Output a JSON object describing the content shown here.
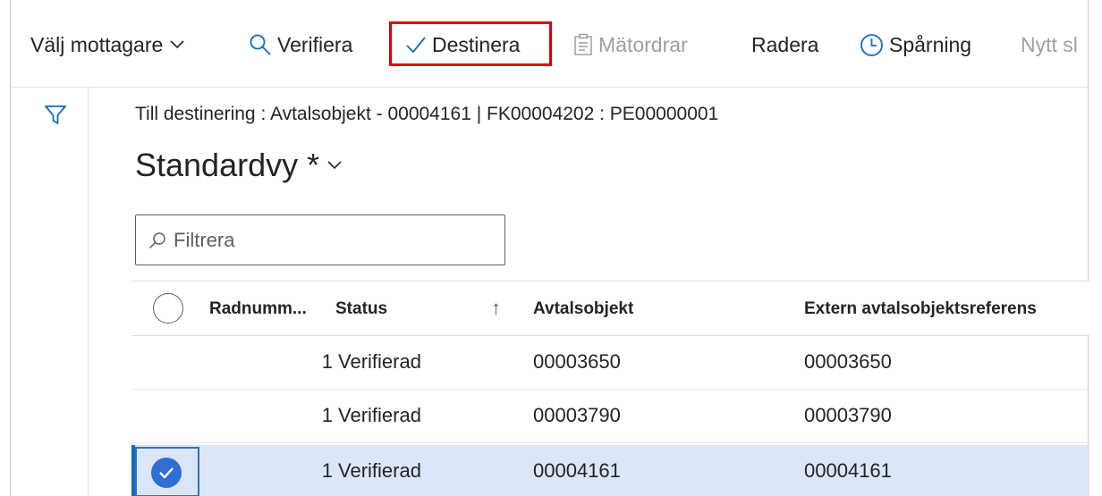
{
  "toolbar": {
    "recipient_label": "Välj mottagare",
    "verify_label": "Verifiera",
    "destine_label": "Destinera",
    "meter_orders_label": "Mätordrar",
    "delete_label": "Radera",
    "tracking_label": "Spårning",
    "new_label": "Nytt sl"
  },
  "header": {
    "subtitle": "Till destinering : Avtalsobjekt - 00004161   |  FK00004202 : PE00000001",
    "view_title": "Standardvy *"
  },
  "filter": {
    "placeholder": "Filtrera"
  },
  "grid": {
    "columns": {
      "row_number": "Radnumm...",
      "status": "Status",
      "contract_object": "Avtalsobjekt",
      "external_ref": "Extern avtalsobjektsreferens"
    },
    "sort_indicator": "↑",
    "rows": [
      {
        "row_number": "1",
        "status": "Verifierad",
        "contract_object": "00003650",
        "external_ref": "00003650",
        "selected": false
      },
      {
        "row_number": "1",
        "status": "Verifierad",
        "contract_object": "00003790",
        "external_ref": "00003790",
        "selected": false
      },
      {
        "row_number": "1",
        "status": "Verifierad",
        "contract_object": "00004161",
        "external_ref": "00004161",
        "selected": true
      }
    ]
  },
  "colors": {
    "accent": "#0f6cbd",
    "highlight_border": "#e00000",
    "selected_row": "#dce6f9",
    "disabled_text": "#a19f9d"
  },
  "icons": [
    "chevron-down-icon",
    "search-icon",
    "checkmark-icon",
    "clipboard-icon",
    "clock-icon",
    "filter-icon",
    "checkbox-circle-icon",
    "sort-up-icon",
    "check-circle-icon"
  ]
}
